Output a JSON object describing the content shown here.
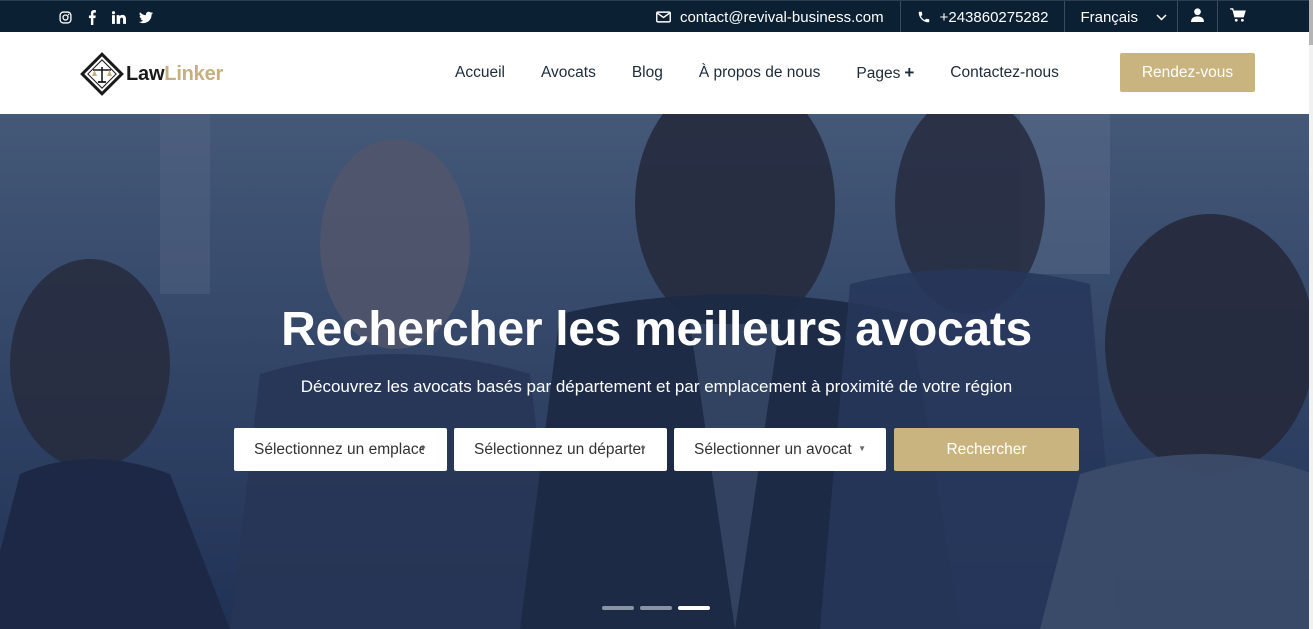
{
  "topbar": {
    "social": [
      "instagram-icon",
      "facebook-icon",
      "linkedin-icon",
      "twitter-icon"
    ],
    "email": "contact@revival-business.com",
    "phone": "+243860275282",
    "language": "Français"
  },
  "header": {
    "logo": {
      "part1": "Law",
      "part2": "Linker"
    },
    "nav": [
      "Accueil",
      "Avocats",
      "Blog",
      "À propos de nous",
      "Pages",
      "Contactez-nous"
    ],
    "pages_plus": "+",
    "cta": "Rendez-vous"
  },
  "hero": {
    "title": "Rechercher les meilleurs avocats",
    "subtitle": "Découvrez les avocats basés par département et par emplacement à proximité de votre région",
    "select_location": "Sélectionnez un emplacement",
    "select_department": "Sélectionnez un département",
    "select_lawyer": "Sélectionner un avocat",
    "search_button": "Rechercher",
    "slides": 3,
    "active_slide": 3
  },
  "colors": {
    "topbar_bg": "#0c2033",
    "accent_gold": "#c9b47f",
    "hero_overlay": "#1e2f4e"
  }
}
